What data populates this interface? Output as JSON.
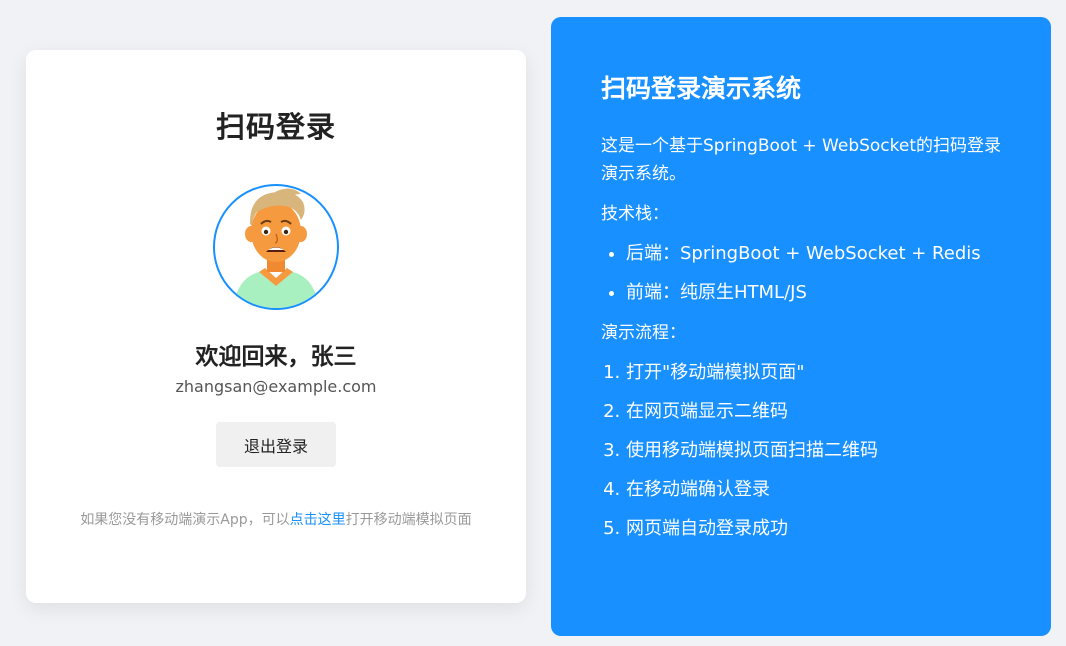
{
  "login": {
    "title": "扫码登录",
    "welcome": "欢迎回来，张三",
    "email": "zhangsan@example.com",
    "logout_label": "退出登录",
    "hint_prefix": "如果您没有移动端演示App，可以",
    "hint_link": "点击这里",
    "hint_suffix": "打开移动端模拟页面"
  },
  "info": {
    "title": "扫码登录演示系统",
    "description": "这是一个基于SpringBoot + WebSocket的扫码登录演示系统。",
    "stack_label": "技术栈：",
    "stack_items": [
      "后端：SpringBoot + WebSocket + Redis",
      "前端：纯原生HTML/JS"
    ],
    "flow_label": "演示流程：",
    "flow_items": [
      "打开\"移动端模拟页面\"",
      "在网页端显示二维码",
      "使用移动端模拟页面扫描二维码",
      "在移动端确认登录",
      "网页端自动登录成功"
    ]
  },
  "colors": {
    "accent": "#1890ff",
    "background": "#f0f2f5",
    "card": "#ffffff"
  },
  "icons": {
    "avatar": "user-avatar-illustration"
  }
}
